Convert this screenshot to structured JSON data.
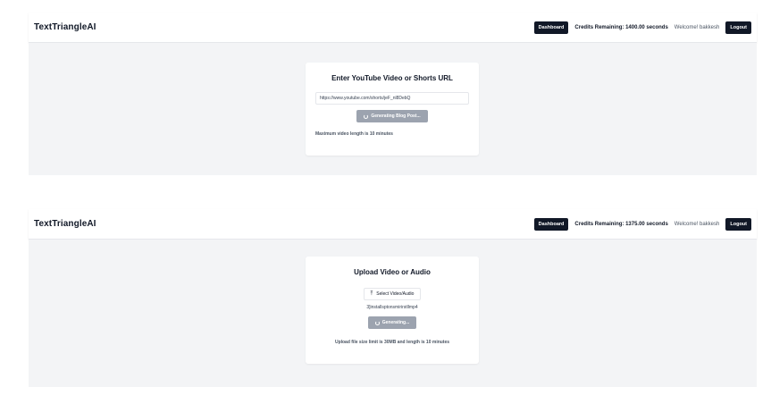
{
  "screen1": {
    "header": {
      "brand": "TextTriangleAI",
      "dashboard_label": "Dashboard",
      "credits": "Credits Remaining: 1400.00 seconds",
      "welcome": "Welcome! bakkesh",
      "logout_label": "Logout"
    },
    "card": {
      "title": "Enter YouTube Video or Shorts URL",
      "url_value": "https://www.youtube.com/shorts/jeF_nl8DebQ",
      "button_label": "Generating Blog Post...",
      "note": "Maximum video length is 10 minutes"
    }
  },
  "screen2": {
    "header": {
      "brand": "TextTriangleAI",
      "dashboard_label": "Dashboard",
      "credits": "Credits Remaining: 1375.00 seconds",
      "welcome": "Welcome! bakkesh",
      "logout_label": "Logout"
    },
    "card": {
      "title": "Upload Video or Audio",
      "select_label": "Select Video/Audio",
      "filename": "3]installsptonsmirirstllmp4",
      "button_label": "Generating...",
      "note": "Upload file size limit is 30MB and length is 10 minutes"
    }
  },
  "icons": {
    "spinner": "spinner-icon",
    "upload": "upload-icon"
  }
}
